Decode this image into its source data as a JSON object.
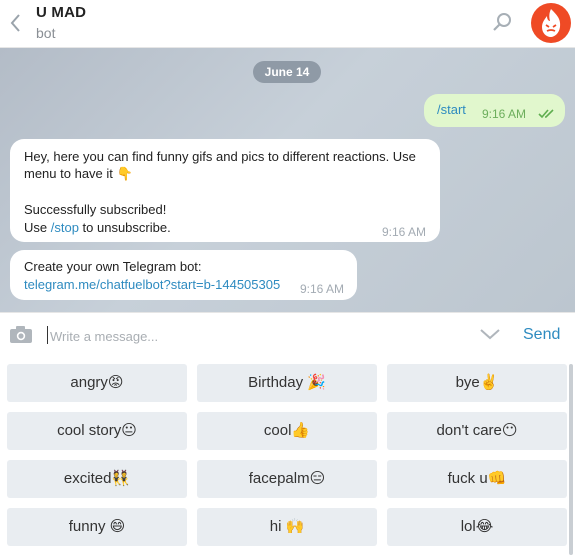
{
  "header": {
    "back_icon": "chevron-left-icon",
    "title": "U MAD",
    "subtitle": "bot",
    "search_icon": "search-icon",
    "avatar_icon": "flame-face-icon",
    "avatar_color": "#ef4a25"
  },
  "chat": {
    "date": "June 14",
    "outgoing": {
      "text": "/start",
      "time": "9:16 AM",
      "read_icon": "double-check-icon"
    },
    "messages": [
      {
        "lines": [
          "Hey, here you can find funny gifs and pics to different reactions. Use",
          "menu to have it 👇",
          "",
          "Successfully subscribed!"
        ],
        "last_prefix": "Use ",
        "last_link": "/stop",
        "last_suffix": " to unsubscribe.",
        "time": "9:16 AM"
      },
      {
        "line1": "Create your own Telegram bot:",
        "link": "telegram.me/chatfuelbot?start=b-144505305",
        "time": "9:16 AM"
      }
    ]
  },
  "input": {
    "placeholder": "Write a message...",
    "send_label": "Send",
    "camera_icon": "camera-icon",
    "chevron_icon": "chevron-down-icon"
  },
  "keyboard": {
    "buttons": [
      "angry😡",
      "Birthday 🎉",
      "bye✌️",
      "cool story😐",
      "cool👍",
      "don't care😶",
      "excited👯",
      "facepalm😑",
      "fuck u👊",
      "funny 😄",
      "hi 🙌",
      "lol😂"
    ]
  },
  "colors": {
    "accent": "#2e8bc0",
    "outgoing_bubble": "#e1f7cd",
    "chat_background": "#c1cad3",
    "keyboard_button": "#e9edf1"
  }
}
